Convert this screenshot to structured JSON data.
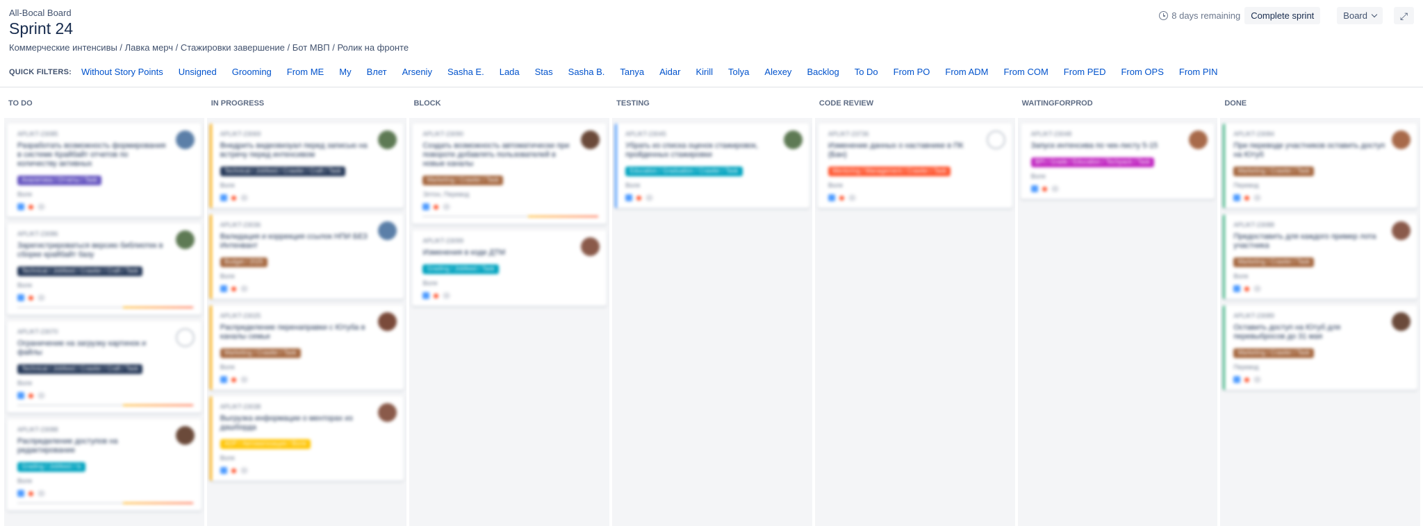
{
  "header": {
    "board_name": "All-Bocal Board",
    "sprint_title": "Sprint 24",
    "goals": "Коммерческие интенсивы / Лавка мерч / Стажировки завершение / Бот МВП / Ролик на фронте"
  },
  "actions": {
    "remaining": "8 days remaining",
    "complete_label": "Complete sprint",
    "board_label": "Board"
  },
  "filters": {
    "label": "QUICK FILTERS:",
    "items": [
      "Without Story Points",
      "Unsigned",
      "Grooming",
      "From ME",
      "My",
      "Влет",
      "Arseniy",
      "Sasha E.",
      "Lada",
      "Stas",
      "Sasha B.",
      "Tanya",
      "Aidar",
      "Kirill",
      "Tolya",
      "Alexey",
      "Backlog",
      "To Do",
      "From PO",
      "From ADM",
      "From COM",
      "From PED",
      "From OPS",
      "From PIN"
    ]
  },
  "colors": {
    "link": "#0052cc",
    "column_bg": "#f4f5f7"
  },
  "columns": [
    {
      "title": "TO DO",
      "cards": [
        {
          "key": "APLIKT-23085",
          "summary": "Разработать возможность формирования в системе Крайбайт отчетов по количеству активных",
          "label": "Аналитика / Отчеты / Task",
          "label_color": "#6554c0",
          "sub": "Воля",
          "avatar": "#5b7fa8",
          "progress": false
        },
        {
          "key": "APLIKT-23086",
          "summary": "Зарегистрироваться версию библиотек в сборке крайбайт базу",
          "label": "Technical / Jobfeed / Crawler / Craft / Task",
          "label_color": "#253858",
          "sub": "Воля",
          "avatar": "#5e7a54",
          "progress": true
        },
        {
          "key": "APLIKT-23070",
          "summary": "Ограничение на загрузку картинок и файлы",
          "label": "Technical / Jobfeed / Crawler / Craft / Task",
          "label_color": "#253858",
          "sub": "Воля",
          "avatar": "",
          "progress": true
        },
        {
          "key": "APLIKT-23088",
          "summary": "Распределение доступов на редактирование",
          "label": "Grading / Jobfeed / Is",
          "label_color": "#00a3bf",
          "sub": "Воля",
          "avatar": "#6b4a3a",
          "progress": true
        }
      ]
    },
    {
      "title": "IN PROGRESS",
      "cards": [
        {
          "key": "APLIKT-23069",
          "summary": "Внедрить видеовизуал перед записью на встречу перед интенсивом",
          "label": "Technical / Jobfeed / Crawler / Craft / Task",
          "label_color": "#253858",
          "sub": "Воля",
          "avatar": "#5e7a54",
          "progress": false
        },
        {
          "key": "APLIKT-23036",
          "summary": "Валидация и коррекция ссылок НПИ БЕЗ Интенвант",
          "label": "Budget / 2025",
          "label_color": "#a5673f",
          "sub": "Воля",
          "avatar": "#5b7fa8",
          "progress": false
        },
        {
          "key": "APLIKT-23025",
          "summary": "Распределение перенаправки с Ютуба в каналы семьи",
          "label": "Marketing / Crawler / Task",
          "label_color": "#a5673f",
          "sub": "Воля",
          "avatar": "#7a4a3a",
          "progress": false
        },
        {
          "key": "APLIKT-23038",
          "summary": "Выгрузка информации о менторах из дашборда",
          "label": "ADP / Автоматизация / Воля",
          "label_color": "#ffc400",
          "sub": "Воля",
          "avatar": "#8a5a4a",
          "progress": false
        }
      ]
    },
    {
      "title": "BLOCK",
      "cards": [
        {
          "key": "APLIKT-23090",
          "summary": "Создать возможность автоматически при повороте добавлять пользователей в новые каналы",
          "label": "Marketing / Crawler / Task",
          "label_color": "#a5673f",
          "sub": "Элтон, Перевод",
          "avatar": "#6b4a3a",
          "progress": true
        },
        {
          "key": "APLIKT-23099",
          "summary": "Изменения в коде ДТМ",
          "label": "Grading / Jobfeed / Task",
          "label_color": "#00a3bf",
          "sub": "Воля",
          "avatar": "#8a5a4a",
          "progress": false
        }
      ]
    },
    {
      "title": "TESTING",
      "cards": [
        {
          "key": "APLIKT-23045",
          "summary": "Убрать из списка оценок стажировок, пройденных стажировки",
          "label": "Education / Graduation / Crawler / Task",
          "label_color": "#00a3bf",
          "sub": "Воля",
          "avatar": "#5e7a54",
          "progress": false
        }
      ]
    },
    {
      "title": "CODE REVIEW",
      "cards": [
        {
          "key": "APLIKT-23736",
          "summary": "Изменение данных о наставнике в ПК (Бан)",
          "label": "Mentoring / Management / Crawler / Task",
          "label_color": "#ff5630",
          "sub": "Воля",
          "avatar": "",
          "progress": false
        }
      ]
    },
    {
      "title": "WAITINGFORPROD",
      "cards": [
        {
          "key": "APLIKT-23048",
          "summary": "Запуск интенсива по чек-листу 5-15",
          "label": "BPI / Grade / Education / Techpack / Task",
          "label_color": "#c024c0",
          "sub": "Воля",
          "avatar": "#a86a4a",
          "progress": false
        }
      ]
    },
    {
      "title": "DONE",
      "cards": [
        {
          "key": "APLIKT-23084",
          "summary": "При переводе участников оставить доступ на Ютуб",
          "label": "Marketing / Crawler / Task",
          "label_color": "#a5673f",
          "sub": "Перевод",
          "avatar": "#a86a4a",
          "progress": false
        },
        {
          "key": "APLIKT-23088",
          "summary": "Предоставить для каждого пример лота участника",
          "label": "Marketing / Crawler / Task",
          "label_color": "#a5673f",
          "sub": "Воля",
          "avatar": "#8a5a4a",
          "progress": false
        },
        {
          "key": "APLIKT-23089",
          "summary": "Оставить доступ на Ютуб для перевыбросов до 31 мая",
          "label": "Marketing / Crawler / Task",
          "label_color": "#a5673f",
          "sub": "Перевод",
          "avatar": "#6b4a3a",
          "progress": false
        }
      ]
    }
  ]
}
